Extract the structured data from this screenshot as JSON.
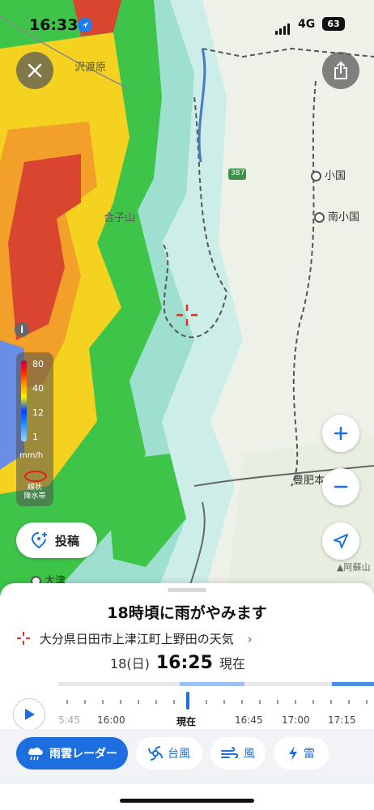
{
  "status_bar": {
    "time": "16:33",
    "network": "4G",
    "battery": "63"
  },
  "map": {
    "labels": [
      "沢渡原",
      "小国",
      "南小国",
      "合子山",
      "387",
      "豊肥本",
      "大津",
      "阿蘇山"
    ],
    "legend": {
      "levels": [
        "80",
        "40",
        "12",
        "1"
      ],
      "unit": "mm/h",
      "band_label": "線状\n降水帯"
    },
    "info_icon": "i"
  },
  "buttons": {
    "post_label": "投稿"
  },
  "sheet": {
    "headline": "18時頃に雨がやみます",
    "place": "大分県日田市上津江町上野田の天気",
    "obs_date": "18(日)",
    "obs_time": "16:25",
    "obs_suffix": "現在"
  },
  "timeline": {
    "labels": [
      "5:45",
      "16:00",
      "現在",
      "16:45",
      "17:00",
      "17:15"
    ]
  },
  "tabs": [
    {
      "label": "雨雲レーダー",
      "icon": "rain-cloud-icon"
    },
    {
      "label": "台風",
      "icon": "typhoon-icon"
    },
    {
      "label": "風",
      "icon": "wind-icon"
    },
    {
      "label": "雷",
      "icon": "lightning-icon"
    }
  ],
  "colors": {
    "accent": "#1d6fe0",
    "radar_heavy": "#d9452e",
    "radar_mid": "#f5d21f",
    "radar_light": "#3fc44a"
  }
}
